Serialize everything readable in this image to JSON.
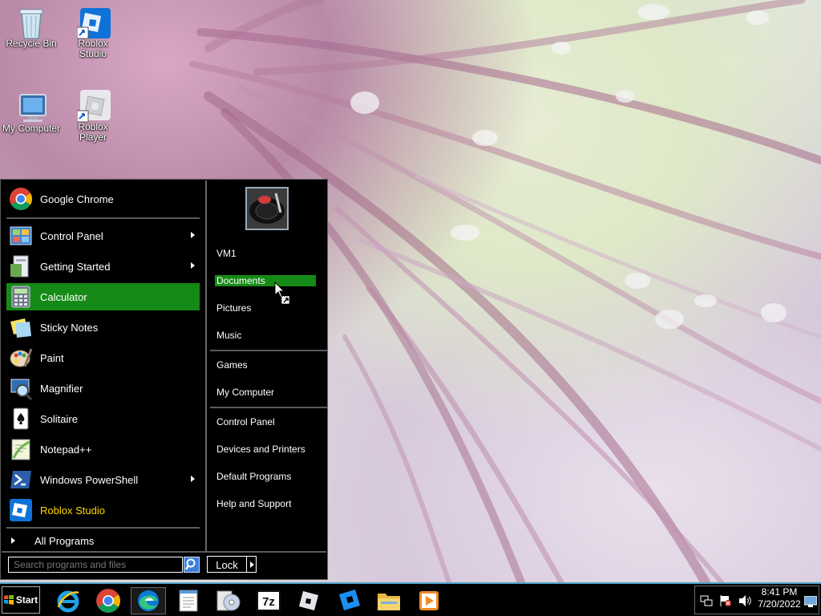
{
  "desktop": {
    "icons": [
      {
        "label_line1": "Recycle Bin",
        "label_line2": ""
      },
      {
        "label_line1": "Roblox",
        "label_line2": "Studio"
      },
      {
        "label_line1": "My Computer",
        "label_line2": ""
      },
      {
        "label_line1": "Roblox",
        "label_line2": "Player"
      }
    ]
  },
  "start_menu": {
    "pinned": [
      {
        "label": "Google Chrome",
        "icon": "chrome-icon"
      },
      {
        "label": "Control Panel",
        "icon": "control-panel-icon",
        "submenu": true
      },
      {
        "label": "Getting Started",
        "icon": "getting-started-icon",
        "submenu": true
      },
      {
        "label": "Calculator",
        "icon": "calculator-icon",
        "selected": true
      },
      {
        "label": "Sticky Notes",
        "icon": "sticky-notes-icon"
      },
      {
        "label": "Paint",
        "icon": "paint-icon"
      },
      {
        "label": "Magnifier",
        "icon": "magnifier-icon"
      },
      {
        "label": "Solitaire",
        "icon": "solitaire-icon"
      },
      {
        "label": "Notepad++",
        "icon": "notepadpp-icon"
      },
      {
        "label": "Windows PowerShell",
        "icon": "powershell-icon",
        "submenu": true
      },
      {
        "label": "Roblox Studio",
        "icon": "roblox-studio-icon",
        "highlight": "#ffd700"
      }
    ],
    "all_programs": "All Programs",
    "search_placeholder": "Search programs and files",
    "right": {
      "user": "VM1",
      "items_group1": [
        "Documents",
        "Pictures",
        "Music"
      ],
      "items_group2": [
        "Games",
        "My Computer"
      ],
      "items_group3": [
        "Control Panel",
        "Devices and Printers",
        "Default Programs",
        "Help and Support"
      ],
      "selected": "Documents"
    },
    "lock_label": "Lock"
  },
  "taskbar": {
    "start_label": "Start",
    "icons": [
      "internet-explorer-icon",
      "chrome-icon",
      "edge-icon",
      "notepad-icon",
      "disc-burner-icon",
      "7zip-icon",
      "roblox-icon",
      "roblox-studio-icon",
      "file-explorer-icon",
      "media-player-icon"
    ],
    "active": "edge-icon",
    "clock_time": "8:41 PM",
    "clock_date": "7/20/2022"
  },
  "colors": {
    "selection": "#168a16",
    "taskbar_border": "#4fa3c7",
    "accent_yellow": "#ffd700"
  }
}
